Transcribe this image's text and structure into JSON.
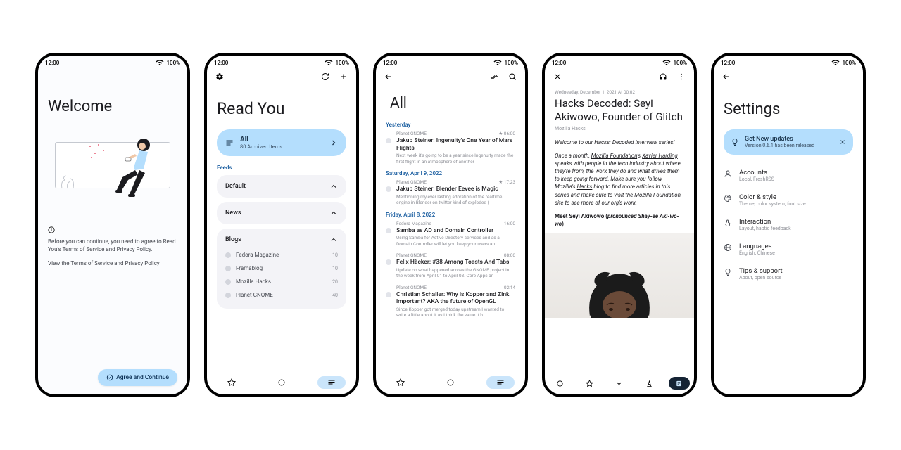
{
  "status": {
    "time": "12:00",
    "battery": "100%"
  },
  "p1": {
    "title": "Welcome",
    "terms_text": "Before you can continue, you need to agree to Read You's Terms of Service and Privacy Policy.",
    "view_prefix": "View the ",
    "terms_link": "Terms of Service and Privacy Policy",
    "agree_btn": "Agree and Continue"
  },
  "p2": {
    "title": "Read You",
    "all_title": "All",
    "all_sub": "80 Archived Items",
    "feeds_label": "Feeds",
    "groups": [
      {
        "name": "Default",
        "items": []
      },
      {
        "name": "News",
        "items": []
      },
      {
        "name": "Blogs",
        "items": [
          {
            "name": "Fedora Magazine",
            "count": "10"
          },
          {
            "name": "Framablog",
            "count": "10"
          },
          {
            "name": "Mozilla Hacks",
            "count": "20"
          },
          {
            "name": "Planet GNOME",
            "count": "40"
          }
        ]
      }
    ]
  },
  "p3": {
    "title": "All",
    "sections": [
      {
        "date": "Yesterday",
        "articles": [
          {
            "source": "Planet GNOME",
            "time": "★ 06:00",
            "title": "Jakub Steiner: Ingenuity's One Year of Mars Flights",
            "snippet": "Next week it's going to be a year since Ingenuity made the first flight in an atmosphere of another"
          }
        ]
      },
      {
        "date": "Saturday, April 9, 2022",
        "articles": [
          {
            "source": "Planet GNOME",
            "time": "★ 17:23",
            "title": "Jakub Steiner: Blender Eevee is Magic",
            "snippet": "Mentioning my ever lasting adoration of the realtime engine in Blender on twitter kind of exploded ("
          }
        ]
      },
      {
        "date": "Friday, April 8, 2022",
        "articles": [
          {
            "source": "Fedora Magazine",
            "time": "16:00",
            "title": "Samba as AD and Domain Controller",
            "snippet": "Using Samba for Active Directory services and as a Domain Controller will let you keep your users an"
          },
          {
            "source": "Planet GNOME",
            "time": "08:00",
            "title": "Felix Häcker: #38 Among Toasts And Tabs",
            "snippet": "Update on what happened across the GNOME project in the week from April 01 to April 08. Core Apps an"
          },
          {
            "source": "Planet GNOME",
            "time": "02:14",
            "title": "Christian Schaller: Why is Kopper and Zink important? AKA the future of OpenGL",
            "snippet": "Since Kopper got merged today upstream I wanted to write a little about it as I think the value it b"
          }
        ]
      }
    ]
  },
  "p4": {
    "date": "Wednesday, December 1, 2021 At 00:02",
    "title": "Hacks Decoded: Seyi Akiwowo, Founder of Glitch",
    "source": "Mozilla Hacks",
    "intro": "Welcome to our Hacks: Decoded Interview series!",
    "body1_a": "Once a month, ",
    "body1_link1": "Mozilla Foundation",
    "body1_b": "'s ",
    "body1_link2": "Xavier Harding",
    "body1_c": " speaks with people in the tech industry about where they're from, the work they do and what drives them to keep going forward. Make sure you follow Mozilla's ",
    "body1_link3": "Hacks",
    "body1_d": " blog to find more articles in this series and make sure to visit the Mozilla Foundation site to see more of our org's work.",
    "body2_a": "Meet Seyi Akiwowo (",
    "body2_b": "pronounced Shay-ee Aki-wo-wo",
    "body2_c": ")"
  },
  "p5": {
    "title": "Settings",
    "update_title": "Get New updates",
    "update_sub": "Version 0.6.1 has been released",
    "items": [
      {
        "icon": "accounts",
        "title": "Accounts",
        "sub": "Local, FreshRSS"
      },
      {
        "icon": "palette",
        "title": "Color & style",
        "sub": "Theme, color system, font size"
      },
      {
        "icon": "touch",
        "title": "Interaction",
        "sub": "Layout, haptic feedback"
      },
      {
        "icon": "language",
        "title": "Languages",
        "sub": "English, Chinese"
      },
      {
        "icon": "tips",
        "title": "Tips & support",
        "sub": "About, open source"
      }
    ]
  }
}
